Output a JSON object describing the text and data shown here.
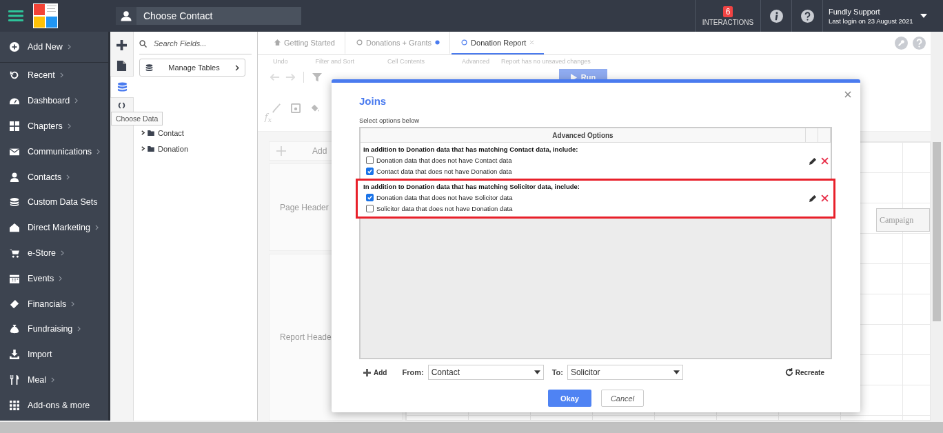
{
  "topbar": {
    "contact_search": {
      "placeholder": "Choose Contact"
    },
    "interactions": {
      "count": "6",
      "label": "INTERACTIONS"
    },
    "user": {
      "name": "Fundly Support",
      "last_login": "Last login on 23 August 2021"
    }
  },
  "sidebar": {
    "items": [
      {
        "label": "Add New",
        "kind": "plus",
        "submenu": true
      },
      {
        "label": "Recent",
        "kind": "recent",
        "submenu": true
      },
      {
        "label": "Dashboard",
        "kind": "gauge",
        "submenu": true
      },
      {
        "label": "Chapters",
        "kind": "grid",
        "submenu": true
      },
      {
        "label": "Communications",
        "kind": "mail",
        "submenu": true
      },
      {
        "label": "Contacts",
        "kind": "person",
        "submenu": true
      },
      {
        "label": "Custom Data Sets",
        "kind": "layers",
        "submenu": false
      },
      {
        "label": "Direct Marketing",
        "kind": "house",
        "submenu": true
      },
      {
        "label": "e-Store",
        "kind": "cart",
        "submenu": true
      },
      {
        "label": "Events",
        "kind": "calendar",
        "submenu": true
      },
      {
        "label": "Financials",
        "kind": "ticket",
        "submenu": true
      },
      {
        "label": "Fundraising",
        "kind": "bag",
        "submenu": true
      },
      {
        "label": "Import",
        "kind": "download",
        "submenu": false
      },
      {
        "label": "Meal",
        "kind": "cutlery",
        "submenu": true
      },
      {
        "label": "Add-ons & more",
        "kind": "apps",
        "submenu": false
      }
    ]
  },
  "rail": {
    "items": [
      {
        "kind": "plus",
        "selected": false
      },
      {
        "kind": "document",
        "selected": false
      },
      {
        "kind": "database",
        "selected": true
      },
      {
        "kind": "brackets",
        "selected": false
      }
    ],
    "tooltip": "Choose Data"
  },
  "fields_panel": {
    "search": {
      "placeholder": "Search Fields..."
    },
    "manage_button": "Manage Tables",
    "tree": [
      {
        "label": "Contact",
        "expanded": false
      },
      {
        "label": "Donation",
        "expanded": false
      }
    ]
  },
  "tabs": [
    {
      "label": "Getting Started",
      "kind": "home",
      "selected": false,
      "unsaved": false,
      "closable": false
    },
    {
      "label": "Donations + Grants",
      "kind": "report",
      "selected": false,
      "unsaved": true,
      "closable": false
    },
    {
      "label": "Donation Report",
      "kind": "report",
      "selected": true,
      "unsaved": false,
      "closable": true
    }
  ],
  "toolbar": {
    "groups": [
      "Undo",
      "Filter and Sort",
      "Cell Contents",
      "Advanced"
    ],
    "save_status": "Report has no unsaved changes",
    "run_button": "Run",
    "formula_label": "f$_{x}$"
  },
  "canvas": {
    "add_label": "Add",
    "bands": [
      "Page Header",
      "Report Heade"
    ],
    "column_header": "Campaign"
  },
  "dialog": {
    "title": "Joins",
    "instructions": "Select options below",
    "table_header": "Advanced Options",
    "joins": [
      {
        "heading": "In addition to Donation data that has matching Contact data, include:",
        "highlighted": false,
        "options": [
          {
            "label": "Donation data that does not have Contact data",
            "checked": false
          },
          {
            "label": "Contact data that does not have Donation data",
            "checked": true
          }
        ]
      },
      {
        "heading": "In addition to Donation data that has matching Solicitor data, include:",
        "highlighted": true,
        "options": [
          {
            "label": "Donation data that does not have Solicitor data",
            "checked": true
          },
          {
            "label": "Solicitor data that does not have Donation data",
            "checked": false
          }
        ]
      }
    ],
    "add_button": "Add",
    "from_label": "From:",
    "from_value": "Contact",
    "to_label": "To:",
    "to_value": "Solicitor",
    "recreate_button": "Recreate",
    "ok_button": "Okay",
    "cancel_button": "Cancel"
  }
}
